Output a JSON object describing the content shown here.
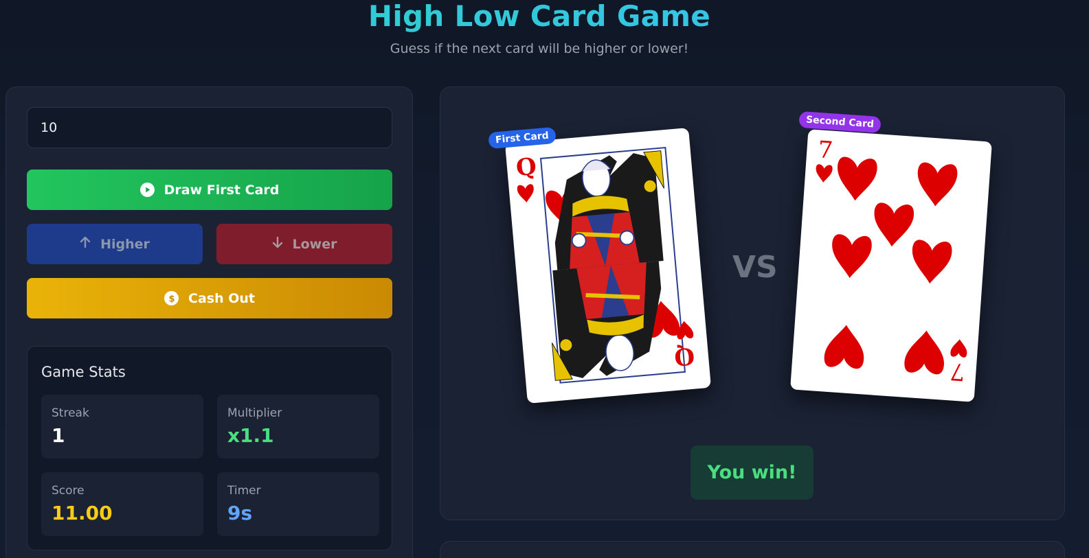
{
  "header": {
    "title": "High Low Card Game",
    "subtitle": "Guess if the next card will be higher or lower!"
  },
  "controls": {
    "bet_value": "10",
    "draw_label": "Draw First Card",
    "higher_label": "Higher",
    "lower_label": "Lower",
    "cashout_label": "Cash Out"
  },
  "stats": {
    "title": "Game Stats",
    "streak_label": "Streak",
    "streak_value": "1",
    "multiplier_label": "Multiplier",
    "multiplier_value": "x1.1",
    "score_label": "Score",
    "score_value": "11.00",
    "timer_label": "Timer",
    "timer_value": "9s"
  },
  "board": {
    "first_tag": "First Card",
    "second_tag": "Second Card",
    "first_rank": "Q",
    "second_rank": "7",
    "suit": "♥",
    "vs": "VS",
    "result": "You win!"
  },
  "colors": {
    "streak": "#ffffff",
    "multiplier": "#4ade80",
    "score": "#facc15",
    "timer": "#60a5fa",
    "heart": "#dd0000"
  }
}
